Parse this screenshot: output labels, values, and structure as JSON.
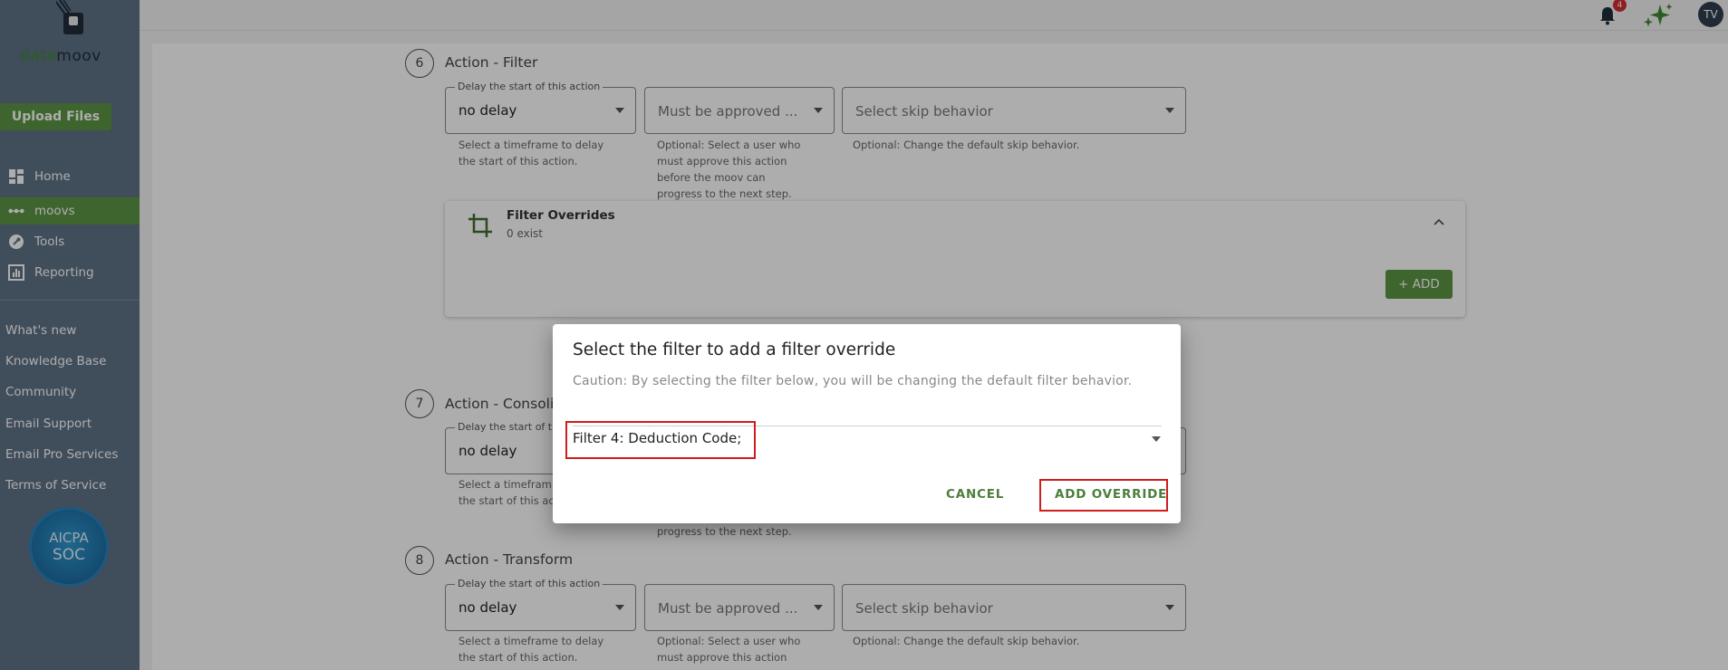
{
  "sidebar": {
    "logo_part1": "data",
    "logo_part2": "moov",
    "upload_label": "Upload Files",
    "nav": [
      {
        "label": "Home",
        "icon": "dashboard-icon"
      },
      {
        "label": "moovs",
        "icon": "flow-icon",
        "active": true
      },
      {
        "label": "Tools",
        "icon": "wrench-icon"
      },
      {
        "label": "Reporting",
        "icon": "report-icon"
      }
    ],
    "links": [
      "What's new",
      "Knowledge Base",
      "Community",
      "Email Support",
      "Email Pro Services",
      "Terms of Service"
    ],
    "badge": {
      "line1": "AICPA",
      "line2": "SOC"
    }
  },
  "topbar": {
    "notification_count": "4",
    "avatar_initials": "TV"
  },
  "steps": [
    {
      "number": "6",
      "title": "Action - Filter",
      "delay_legend": "Delay the start of this action",
      "delay_value": "no delay",
      "delay_helper": [
        "Select a timeframe to delay",
        "the start of this action."
      ],
      "approval_placeholder": "Must be approved ...",
      "approval_helper": [
        "Optional: Select a user who",
        "must approve this action",
        "before the moov can",
        "progress to the next step."
      ],
      "skip_placeholder": "Select skip behavior",
      "skip_helper": "Optional: Change the default skip behavior."
    },
    {
      "number": "7",
      "title": "Action - Consolid",
      "delay_legend": "Delay the start of t",
      "delay_value": "no delay",
      "delay_helper": [
        "Select a timefram",
        "the start of this ac"
      ],
      "approval_tail": "progress to the next step."
    },
    {
      "number": "8",
      "title": "Action - Transform",
      "delay_legend": "Delay the start of this action",
      "delay_value": "no delay",
      "delay_helper": [
        "Select a timeframe to delay",
        "the start of this action."
      ],
      "approval_placeholder": "Must be approved ...",
      "approval_helper": [
        "Optional: Select a user who",
        "must approve this action"
      ],
      "skip_placeholder": "Select skip behavior",
      "skip_helper": "Optional: Change the default skip behavior."
    }
  ],
  "filter_overrides": {
    "title": "Filter Overrides",
    "count_text": "0 exist",
    "add_label": "+ ADD"
  },
  "dialog": {
    "title": "Select the filter to add a filter override",
    "caution": "Caution: By selecting the filter below, you will be changing the default filter behavior.",
    "selected_filter": "Filter 4: Deduction Code;",
    "cancel_label": "CANCEL",
    "confirm_label": "ADD OVERRIDE"
  },
  "colors": {
    "brand_green": "#5e9645",
    "sidebar_bg": "#5f7286",
    "highlight_red": "#d01c1c"
  }
}
